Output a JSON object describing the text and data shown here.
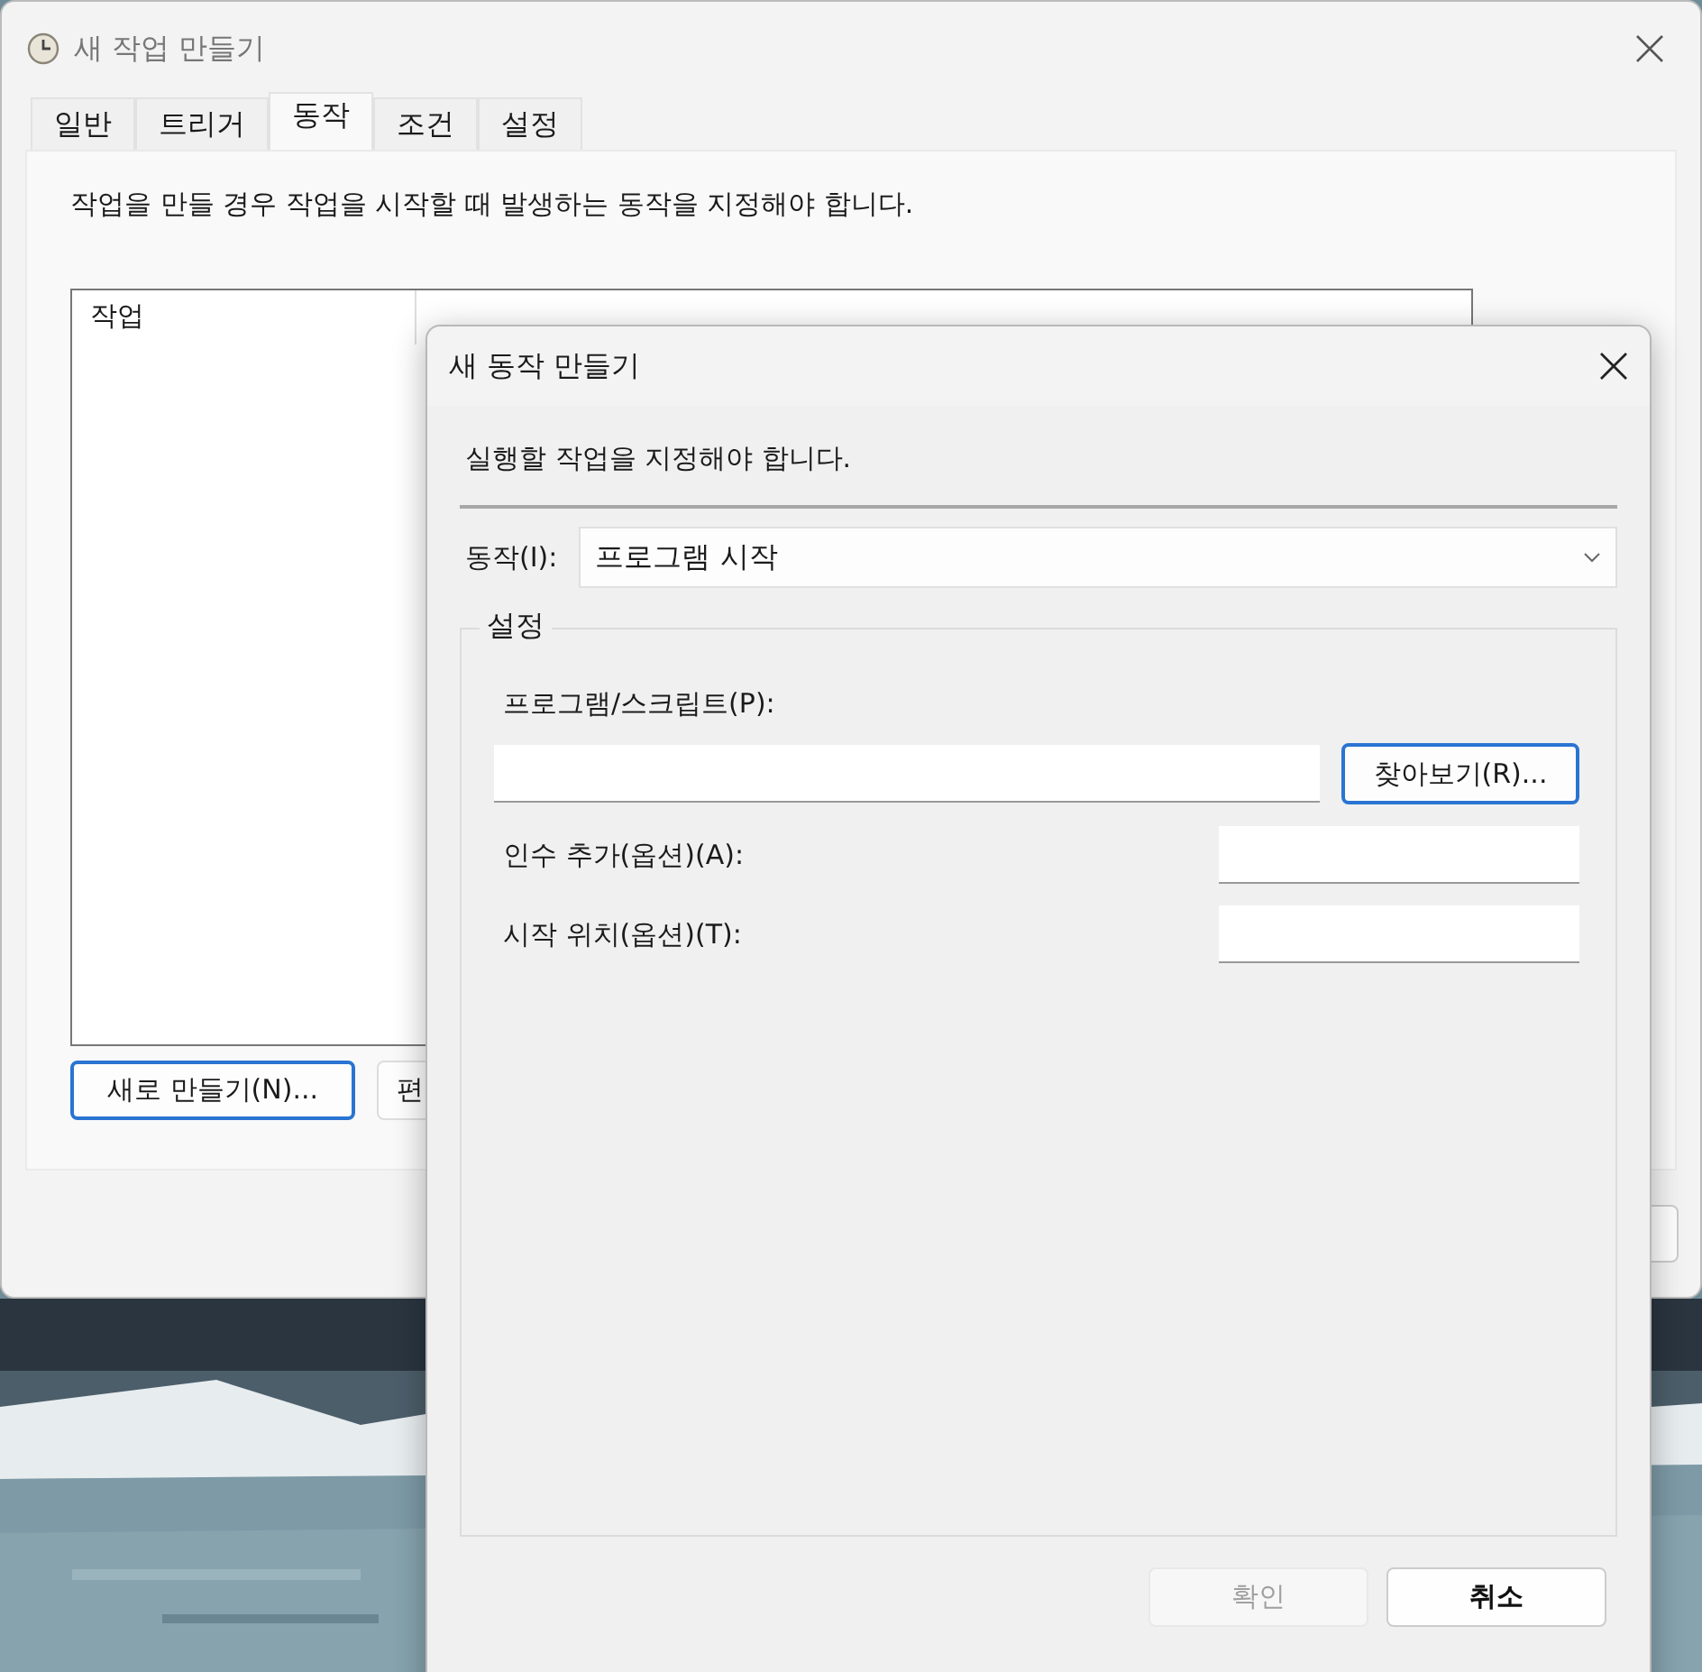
{
  "back_window": {
    "title": "새 작업 만들기",
    "tabs": [
      {
        "label": "일반",
        "selected": false
      },
      {
        "label": "트리거",
        "selected": false
      },
      {
        "label": "동작",
        "selected": true
      },
      {
        "label": "조건",
        "selected": false
      },
      {
        "label": "설정",
        "selected": false
      }
    ],
    "description": "작업을 만들 경우 작업을 시작할 때 발생하는 동작을 지정해야 합니다.",
    "list": {
      "columns": [
        "작업"
      ]
    },
    "buttons": [
      "새로 만들기(N)...",
      "편"
    ]
  },
  "dialog": {
    "title": "새 동작 만들기",
    "instruction": "실행할 작업을 지정해야 합니다.",
    "action": {
      "label": "동작(I):",
      "value": "프로그램 시작"
    },
    "settings": {
      "title": "설정",
      "program": {
        "label": "프로그램/스크립트(P):",
        "browse": "찾아보기(R)..."
      },
      "arguments": {
        "label": "인수 추가(옵션)(A):"
      },
      "start_in": {
        "label": "시작 위치(옵션)(T):"
      }
    },
    "buttons": [
      {
        "label": "확인",
        "disabled": true
      },
      {
        "label": "취소",
        "disabled": false
      }
    ]
  }
}
